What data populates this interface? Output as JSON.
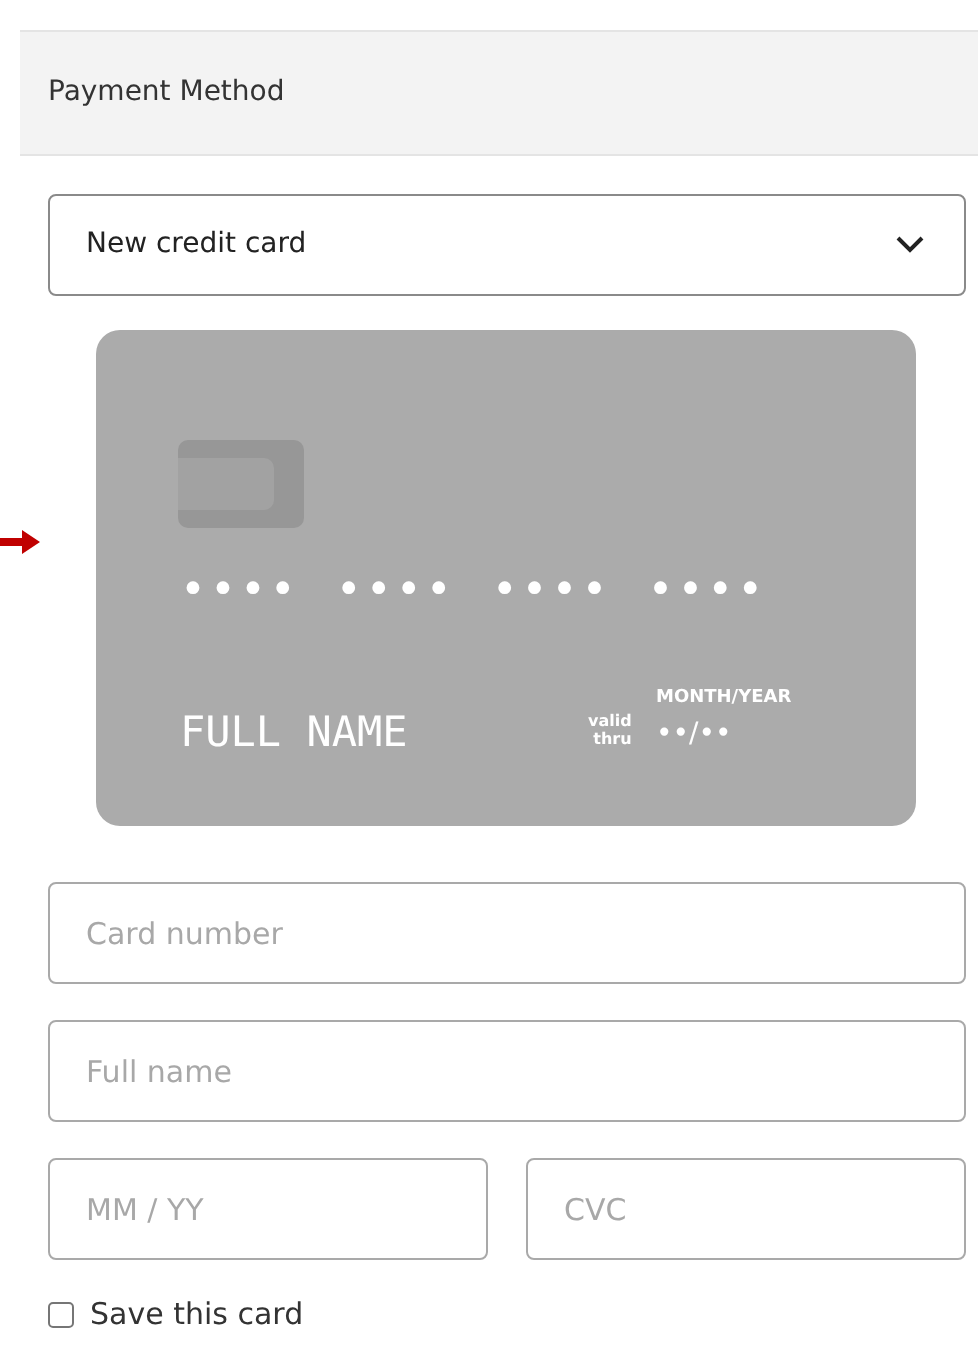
{
  "section": {
    "title": "Payment Method"
  },
  "method_select": {
    "value": "New credit card"
  },
  "card_preview": {
    "number_groups": [
      "••••",
      "••••",
      "••••",
      "••••"
    ],
    "name": "FULL NAME",
    "expiry_caption": "MONTH/YEAR",
    "valid_label": [
      "valid",
      "thru"
    ],
    "expiry": "••/••"
  },
  "fields": [
    {
      "placeholder": "Card number"
    },
    {
      "placeholder": "Full name"
    }
  ],
  "row_fields": [
    {
      "placeholder": "MM / YY"
    },
    {
      "placeholder": "CVC"
    }
  ],
  "save_card": {
    "label": "Save this card",
    "checked": false
  }
}
